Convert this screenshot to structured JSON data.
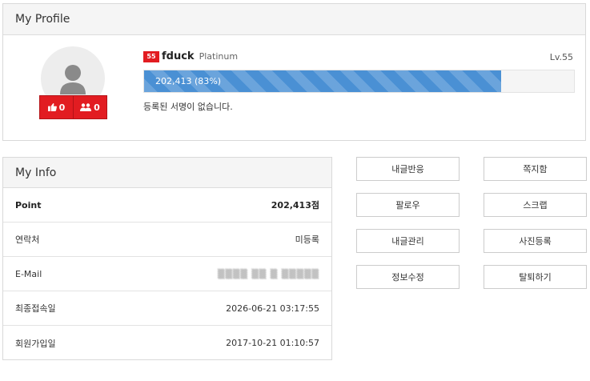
{
  "profile": {
    "title": "My Profile",
    "badge": "55",
    "nickname": "fduck",
    "grade": "Platinum",
    "level": "Lv.55",
    "xp_text": "202,413 (83%)",
    "xp_percent": 83,
    "signature": "등록된 서명이 없습니다.",
    "likes": "0",
    "followers": "0",
    "stats_color": "#e21c21"
  },
  "info": {
    "title": "My Info",
    "rows": [
      {
        "key": "Point",
        "value": "202,413점"
      },
      {
        "key": "연락처",
        "value": "미등록"
      },
      {
        "key": "E-Mail",
        "value": "▒▒▒▒ ▒▒ ▒ ▒▒▒▒▒"
      },
      {
        "key": "최종접속일",
        "value": "2026-06-21 03:17:55"
      },
      {
        "key": "회원가입일",
        "value": "2017-10-21 01:10:57"
      }
    ]
  },
  "buttons": [
    "내글반응",
    "쪽지함",
    "팔로우",
    "스크랩",
    "내글관리",
    "사진등록",
    "정보수정",
    "탈퇴하기"
  ],
  "icons": {
    "like": "thumbs-up-icon",
    "follow": "users-icon",
    "avatar": "user-avatar-icon"
  },
  "colors": {
    "accent_red": "#e21c21",
    "progress_blue": "#4a90d4"
  }
}
